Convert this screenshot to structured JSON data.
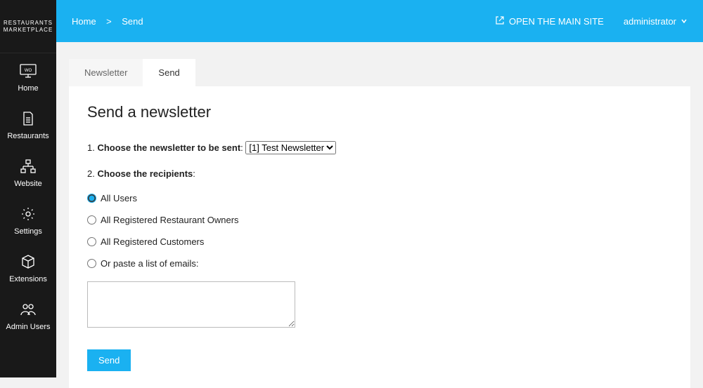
{
  "brand": {
    "line1": "RESTAURANTS",
    "line2": "MARKETPLACE"
  },
  "sidebar": {
    "items": [
      {
        "label": "Home"
      },
      {
        "label": "Restaurants"
      },
      {
        "label": "Website"
      },
      {
        "label": "Settings"
      },
      {
        "label": "Extensions"
      },
      {
        "label": "Admin Users"
      }
    ]
  },
  "breadcrumb": {
    "home": "Home",
    "sep": ">",
    "current": "Send"
  },
  "topbar": {
    "open_site": "OPEN THE MAIN SITE",
    "user": "administrator"
  },
  "tabs": {
    "newsletter": "Newsletter",
    "send": "Send"
  },
  "page": {
    "title": "Send a newsletter",
    "step1_num": "1.",
    "step1_text": "Choose the newsletter to be sent",
    "select_option": "[1] Test Newsletter",
    "step2_num": "2.",
    "step2_text": "Choose the recipients",
    "opt_all_users": "All Users",
    "opt_owners": "All Registered Restaurant Owners",
    "opt_customers": "All Registered Customers",
    "opt_paste": "Or paste a list of emails:",
    "send_btn": "Send"
  }
}
